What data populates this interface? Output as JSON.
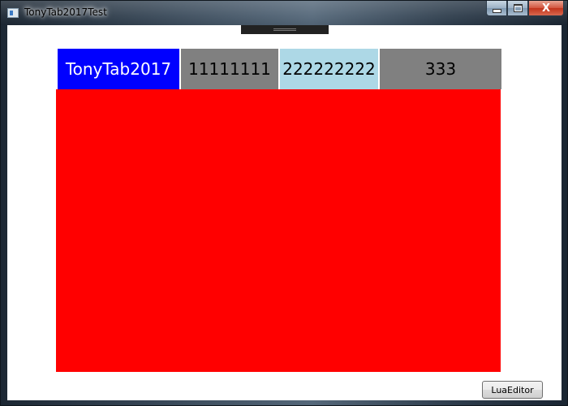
{
  "window": {
    "title": "TonyTab2017Test",
    "icon": "app-window-icon",
    "controls": {
      "minimize_icon": "minimize-icon",
      "maximize_icon": "maximize-icon",
      "close_label": "X"
    }
  },
  "tabs": [
    {
      "label": "TonyTab2017",
      "background": "#0000ff",
      "color": "#ffffff",
      "selected": true
    },
    {
      "label": "11111111",
      "background": "#808080",
      "color": "#000000",
      "selected": false
    },
    {
      "label": "222222222",
      "background": "#add8e6",
      "color": "#000000",
      "selected": false
    },
    {
      "label": "333",
      "background": "#808080",
      "color": "#000000",
      "selected": false
    }
  ],
  "content_panel": {
    "background": "#ff0000"
  },
  "footer": {
    "lua_editor_label": "LuaEditor"
  }
}
